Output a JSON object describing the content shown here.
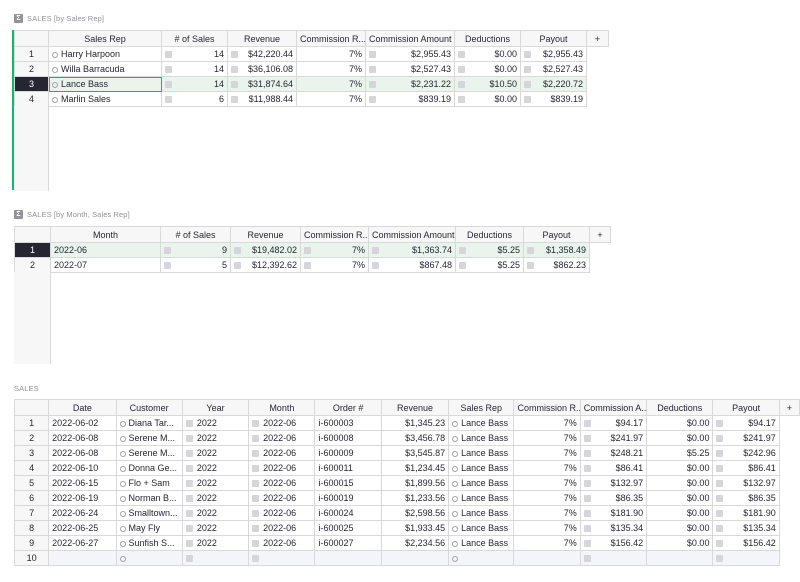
{
  "sections": {
    "one": "SALES [by Sales Rep]",
    "two": "SALES [by Month, Sales Rep]",
    "three": "SALES"
  },
  "add_column_label": "+",
  "rep_table": {
    "headers": [
      "Sales Rep",
      "# of Sales",
      "Revenue",
      "Commission R...",
      "Commission Amount",
      "Deductions",
      "Payout"
    ],
    "rows": [
      {
        "n": "1",
        "rep": "Harry Harpoon",
        "count": "14",
        "revenue": "$42,220.44",
        "rate": "7%",
        "amount": "$2,955.43",
        "ded": "$0.00",
        "payout": "$2,955.43"
      },
      {
        "n": "2",
        "rep": "Willa Barracuda",
        "count": "14",
        "revenue": "$36,106.08",
        "rate": "7%",
        "amount": "$2,527.43",
        "ded": "$0.00",
        "payout": "$2,527.43"
      },
      {
        "n": "3",
        "rep": "Lance Bass",
        "count": "14",
        "revenue": "$31,874.64",
        "rate": "7%",
        "amount": "$2,231.22",
        "ded": "$10.50",
        "payout": "$2,220.72"
      },
      {
        "n": "4",
        "rep": "Marlin Sales",
        "count": "6",
        "revenue": "$11,988.44",
        "rate": "7%",
        "amount": "$839.19",
        "ded": "$0.00",
        "payout": "$839.19"
      }
    ]
  },
  "month_table": {
    "headers": [
      "Month",
      "# of Sales",
      "Revenue",
      "Commission R...",
      "Commission Amount",
      "Deductions",
      "Payout"
    ],
    "rows": [
      {
        "n": "1",
        "month": "2022-06",
        "count": "9",
        "revenue": "$19,482.02",
        "rate": "7%",
        "amount": "$1,363.74",
        "ded": "$5.25",
        "payout": "$1,358.49"
      },
      {
        "n": "2",
        "month": "2022-07",
        "count": "5",
        "revenue": "$12,392.62",
        "rate": "7%",
        "amount": "$867.48",
        "ded": "$5.25",
        "payout": "$862.23"
      }
    ]
  },
  "sales_table": {
    "headers": [
      "Date",
      "Customer",
      "Year",
      "Month",
      "Order #",
      "Revenue",
      "Sales Rep",
      "Commission R...",
      "Commission A...",
      "Deductions",
      "Payout"
    ],
    "rows": [
      {
        "n": "1",
        "date": "2022-06-02",
        "customer": "Diana Tar...",
        "year": "2022",
        "month": "2022-06",
        "order": "i-600003",
        "revenue": "$1,345.23",
        "rep": "Lance Bass",
        "rate": "7%",
        "amount": "$94.17",
        "ded": "$0.00",
        "payout": "$94.17"
      },
      {
        "n": "2",
        "date": "2022-06-08",
        "customer": "Serene M...",
        "year": "2022",
        "month": "2022-06",
        "order": "i-600008",
        "revenue": "$3,456.78",
        "rep": "Lance Bass",
        "rate": "7%",
        "amount": "$241.97",
        "ded": "$0.00",
        "payout": "$241.97"
      },
      {
        "n": "3",
        "date": "2022-06-08",
        "customer": "Serene M...",
        "year": "2022",
        "month": "2022-06",
        "order": "i-600009",
        "revenue": "$3,545.87",
        "rep": "Lance Bass",
        "rate": "7%",
        "amount": "$248.21",
        "ded": "$5.25",
        "payout": "$242.96"
      },
      {
        "n": "4",
        "date": "2022-06-10",
        "customer": "Donna Ge...",
        "year": "2022",
        "month": "2022-06",
        "order": "i-600011",
        "revenue": "$1,234.45",
        "rep": "Lance Bass",
        "rate": "7%",
        "amount": "$86.41",
        "ded": "$0.00",
        "payout": "$86.41"
      },
      {
        "n": "5",
        "date": "2022-06-15",
        "customer": "Flo + Sam",
        "year": "2022",
        "month": "2022-06",
        "order": "i-600015",
        "revenue": "$1,899.56",
        "rep": "Lance Bass",
        "rate": "7%",
        "amount": "$132.97",
        "ded": "$0.00",
        "payout": "$132.97"
      },
      {
        "n": "6",
        "date": "2022-06-19",
        "customer": "Norman B...",
        "year": "2022",
        "month": "2022-06",
        "order": "i-600019",
        "revenue": "$1,233.56",
        "rep": "Lance Bass",
        "rate": "7%",
        "amount": "$86.35",
        "ded": "$0.00",
        "payout": "$86.35"
      },
      {
        "n": "7",
        "date": "2022-06-24",
        "customer": "Smalltown...",
        "year": "2022",
        "month": "2022-06",
        "order": "i-600024",
        "revenue": "$2,598.56",
        "rep": "Lance Bass",
        "rate": "7%",
        "amount": "$181.90",
        "ded": "$0.00",
        "payout": "$181.90"
      },
      {
        "n": "8",
        "date": "2022-06-25",
        "customer": "May Fly",
        "year": "2022",
        "month": "2022-06",
        "order": "i-600025",
        "revenue": "$1,933.45",
        "rep": "Lance Bass",
        "rate": "7%",
        "amount": "$135.34",
        "ded": "$0.00",
        "payout": "$135.34"
      },
      {
        "n": "9",
        "date": "2022-06-27",
        "customer": "Sunfish S...",
        "year": "2022",
        "month": "2022-06",
        "order": "i-600027",
        "revenue": "$2,234.56",
        "rep": "Lance Bass",
        "rate": "7%",
        "amount": "$156.42",
        "ded": "$0.00",
        "payout": "$156.42"
      }
    ],
    "new_row_number": "10"
  },
  "colors": {
    "accent": "#16b378",
    "active_row_bg": "#e8f4ec",
    "header_bg": "#f7f7f7",
    "grid_line": "#d9d9d9"
  }
}
